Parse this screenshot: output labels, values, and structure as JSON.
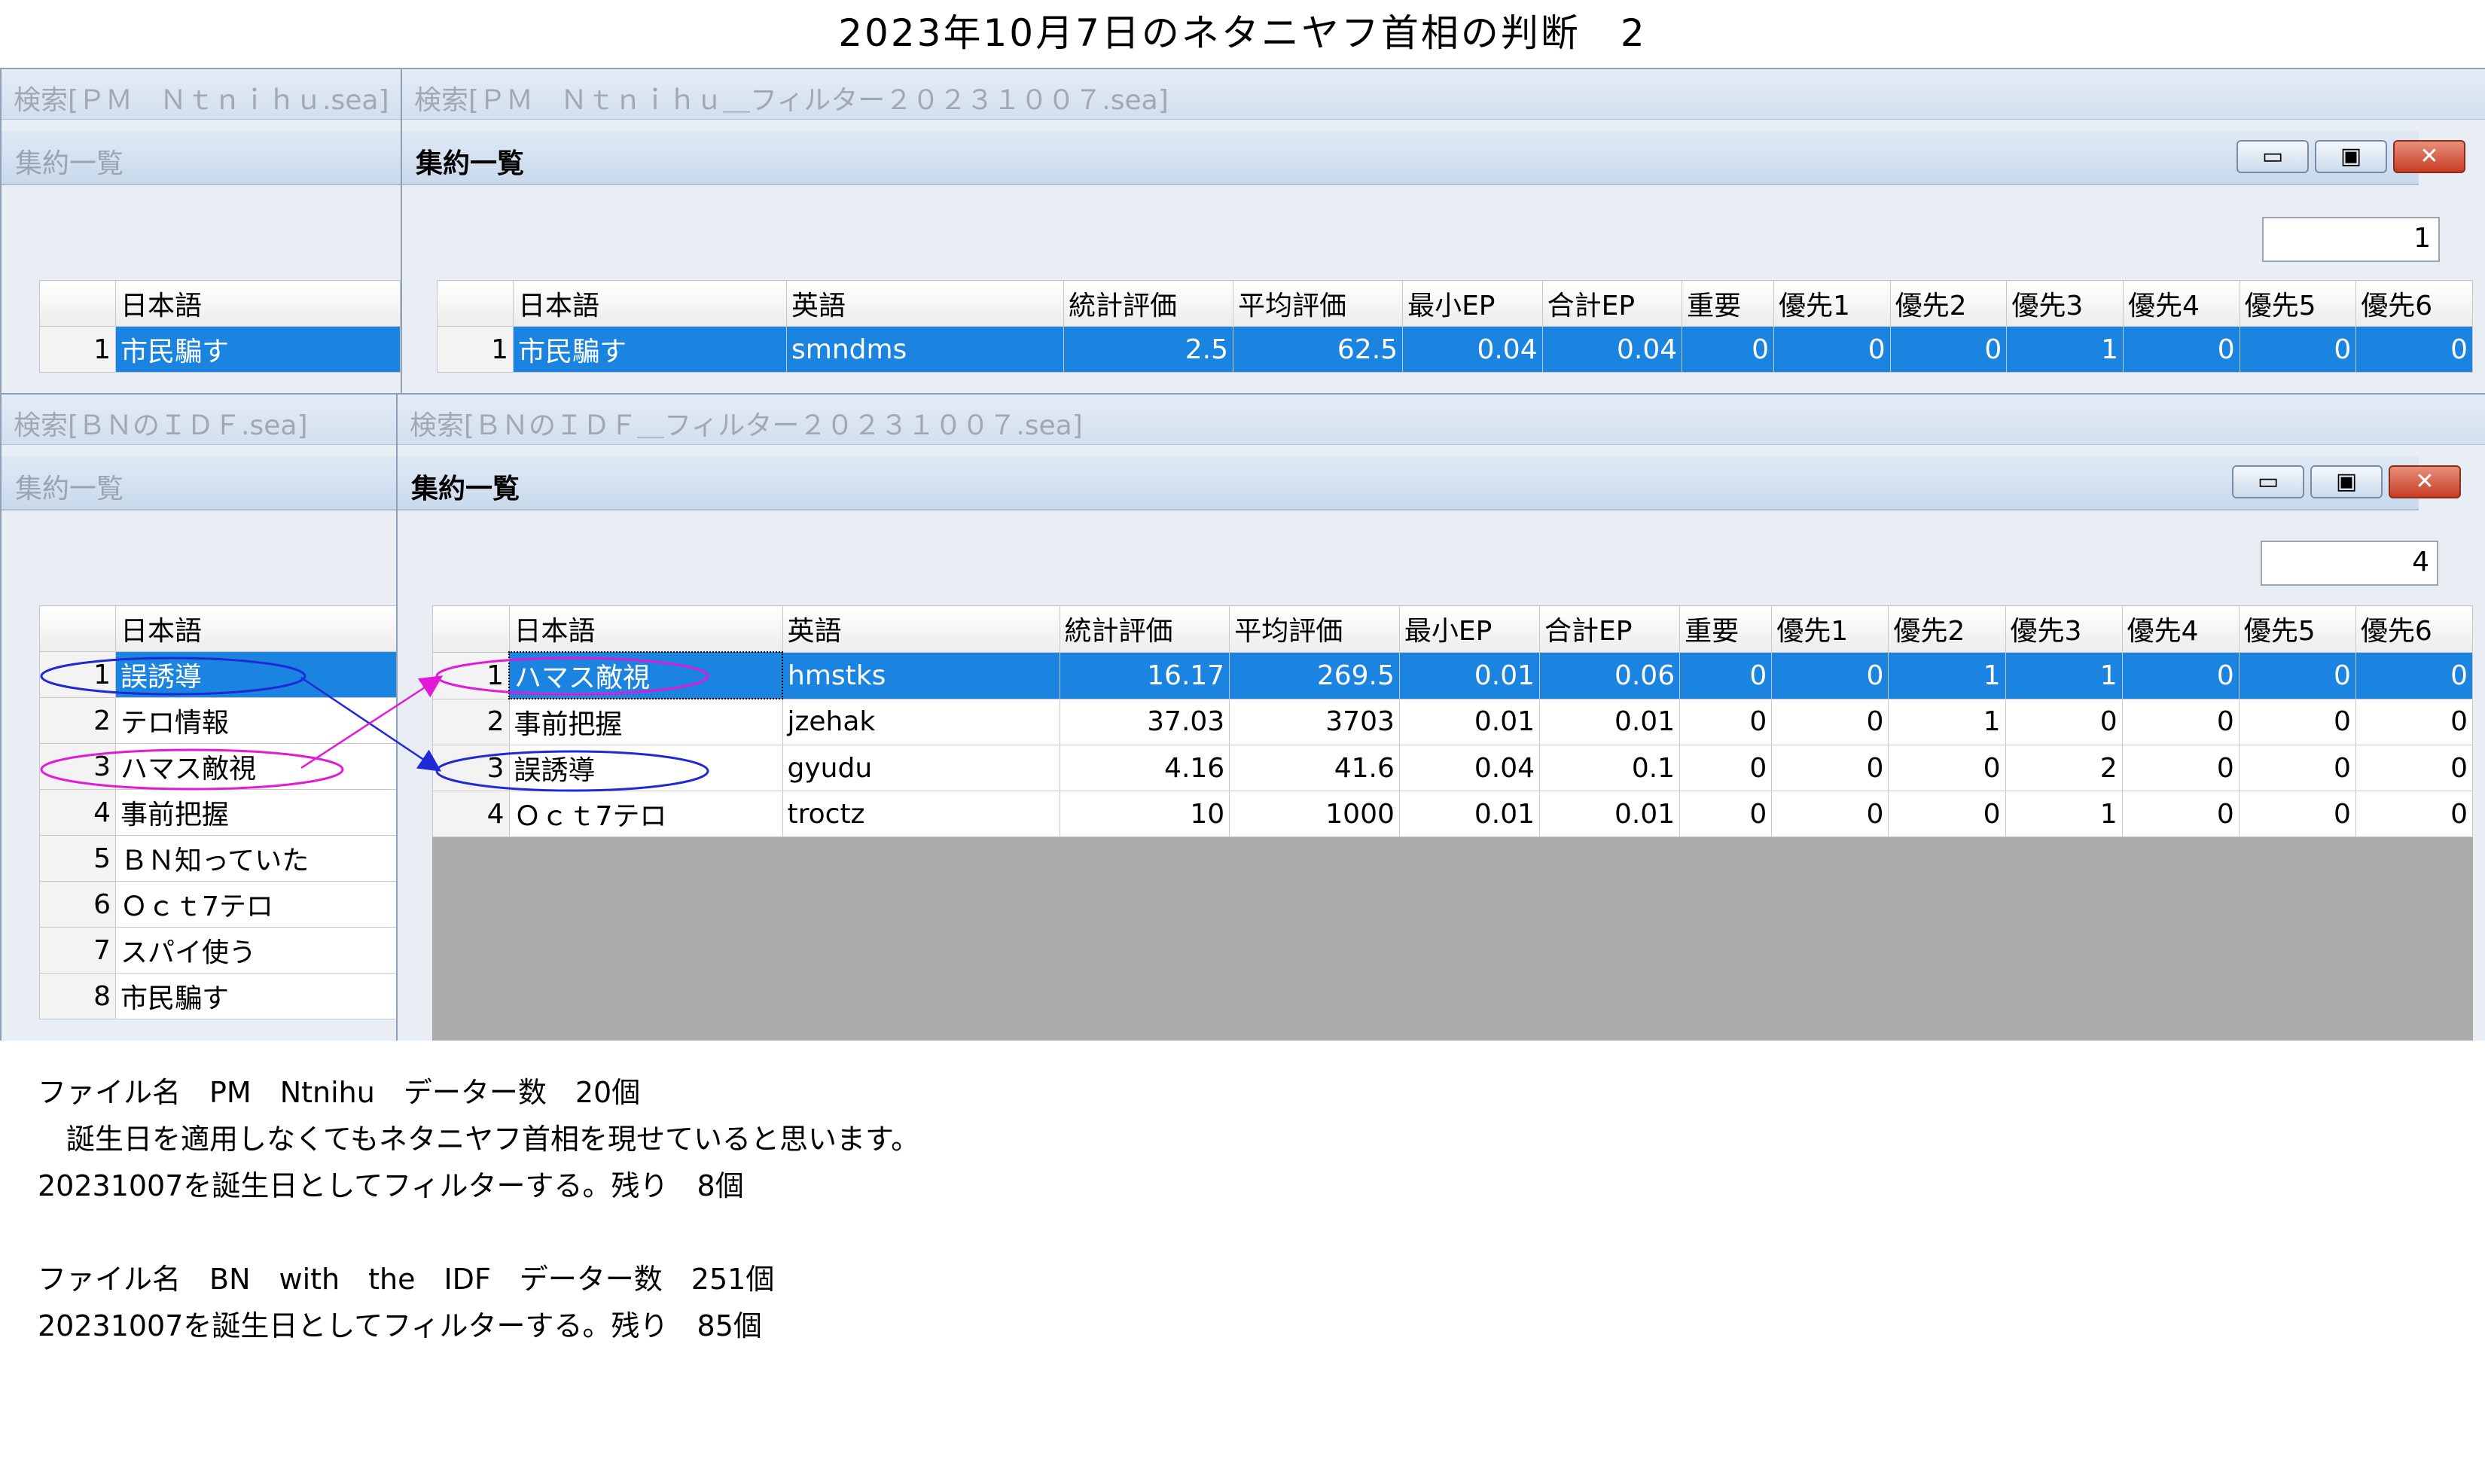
{
  "page_title": "2023年10月7日のネタニヤフ首相の判断　2",
  "top_set": {
    "back_window": {
      "search_title": "検索[ＰＭ　Ｎｔｎｉｈｕ.sea]",
      "panel_title": "集約一覧",
      "header": "日本語",
      "rows": [
        {
          "n": "1",
          "ja": "市民騙す"
        }
      ]
    },
    "front_window": {
      "search_title": "検索[ＰＭ　Ｎｔｎｉｈｕ＿フィルター２０２３１００７.sea]",
      "panel_title": "集約一覧",
      "count": "1",
      "columns": [
        "日本語",
        "英語",
        "統計評価",
        "平均評価",
        "最小EP",
        "合計EP",
        "重要",
        "優先1",
        "優先2",
        "優先3",
        "優先4",
        "優先5",
        "優先6"
      ],
      "rows": [
        {
          "n": "1",
          "cells": [
            "市民騙す",
            "smndms",
            "2.5",
            "62.5",
            "0.04",
            "0.04",
            "0",
            "0",
            "0",
            "1",
            "0",
            "0",
            "0"
          ]
        }
      ]
    }
  },
  "bottom_set": {
    "back_window": {
      "search_title": "検索[ＢＮのＩＤＦ.sea]",
      "panel_title": "集約一覧",
      "header": "日本語",
      "rows": [
        {
          "n": "1",
          "ja": "誤誘導"
        },
        {
          "n": "2",
          "ja": "テロ情報"
        },
        {
          "n": "3",
          "ja": "ハマス敵視"
        },
        {
          "n": "4",
          "ja": "事前把握"
        },
        {
          "n": "5",
          "ja": "ＢＮ知っていた"
        },
        {
          "n": "6",
          "ja": "Ｏｃｔ7テロ"
        },
        {
          "n": "7",
          "ja": "スパイ使う"
        },
        {
          "n": "8",
          "ja": "市民騙す"
        }
      ]
    },
    "front_window": {
      "search_title": "検索[ＢＮのＩＤＦ＿フィルター２０２３１００７.sea]",
      "panel_title": "集約一覧",
      "count": "4",
      "columns": [
        "日本語",
        "英語",
        "統計評価",
        "平均評価",
        "最小EP",
        "合計EP",
        "重要",
        "優先1",
        "優先2",
        "優先3",
        "優先4",
        "優先5",
        "優先6"
      ],
      "rows": [
        {
          "n": "1",
          "cells": [
            "ハマス敵視",
            "hmstks",
            "16.17",
            "269.5",
            "0.01",
            "0.06",
            "0",
            "0",
            "1",
            "1",
            "0",
            "0",
            "0"
          ]
        },
        {
          "n": "2",
          "cells": [
            "事前把握",
            "jzehak",
            "37.03",
            "3703",
            "0.01",
            "0.01",
            "0",
            "0",
            "1",
            "0",
            "0",
            "0",
            "0"
          ]
        },
        {
          "n": "3",
          "cells": [
            "誤誘導",
            "gyudu",
            "4.16",
            "41.6",
            "0.04",
            "0.1",
            "0",
            "0",
            "0",
            "2",
            "0",
            "0",
            "0"
          ]
        },
        {
          "n": "4",
          "cells": [
            "Ｏｃｔ7テロ",
            "troctz",
            "10",
            "1000",
            "0.01",
            "0.01",
            "0",
            "0",
            "0",
            "1",
            "0",
            "0",
            "0"
          ]
        }
      ]
    }
  },
  "window_controls": {
    "minimize": "▭",
    "maximize": "▣",
    "close": "✕"
  },
  "notes": [
    "ファイル名　PM　Ntnihu　データー数　20個",
    "　誕生日を適用しなくてもネタニヤフ首相を現せていると思います。",
    "20231007を誕生日としてフィルターする。残り　8個",
    "",
    "ファイル名　BN　with　the　IDF　データー数　251個",
    "20231007を誕生日としてフィルターする。残り　85個"
  ],
  "colors": {
    "selection": "#1a84e0",
    "annotation_blue": "#1f2ad6",
    "annotation_magenta": "#e21ad8",
    "empty_grid": "#ababab"
  }
}
